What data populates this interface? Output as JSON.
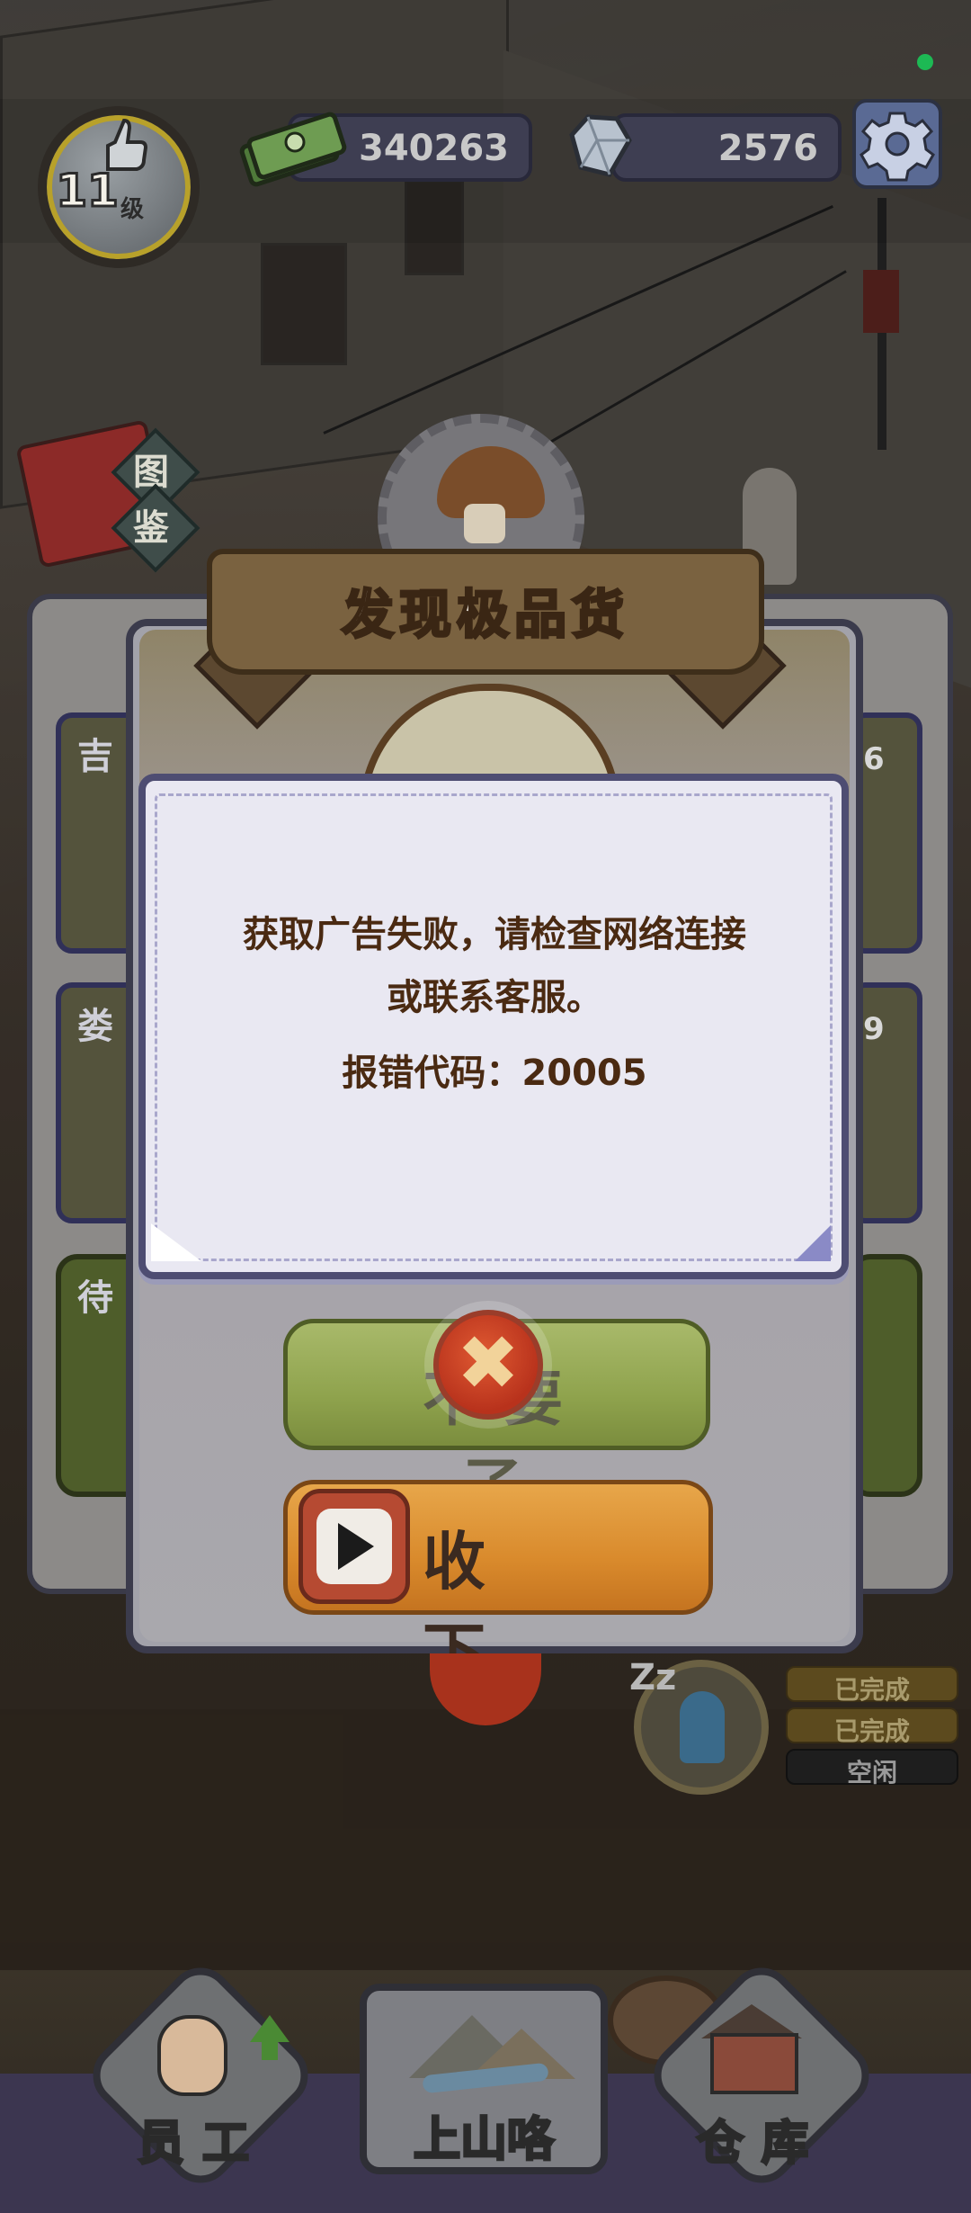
{
  "hud": {
    "level_number": "11",
    "level_unit": "级",
    "cash_amount": "340263",
    "gem_amount": "2576",
    "settings_icon": "gear-icon",
    "cash_icon": "cash-stack-icon",
    "gem_icon": "diamond-gem-icon"
  },
  "side": {
    "encyclopedia_chars": [
      "图",
      "鉴"
    ]
  },
  "background_cards": {
    "left_tags": [
      "吉",
      "娄",
      "待"
    ],
    "right_badges": [
      "6",
      "9"
    ]
  },
  "reward_panel": {
    "title": "发现极品货",
    "decline_button_label": "不要了",
    "accept_button_label": "收 下",
    "accept_icon": "play-icon",
    "decline_icon": "close-icon"
  },
  "error_dialog": {
    "message_line1": "获取广告失败，请检查网络连接",
    "message_line2": "或联系客服。",
    "code_label": "报错代码：20005"
  },
  "worker_status": {
    "chips": [
      "已完成",
      "已完成",
      "空闲"
    ],
    "sleep_text": "Zz"
  },
  "bottom_nav": {
    "items": [
      {
        "label": "员工",
        "icon": "staff-avatar-icon"
      },
      {
        "label": "上山咯",
        "icon": "mountain-icon"
      },
      {
        "label": "仓库",
        "icon": "warehouse-icon"
      }
    ]
  },
  "colors": {
    "dialog_text": "#4a2a12",
    "decline_button": "#8fa34d",
    "accept_button": "#d98a2c",
    "status_online": "#1db954"
  }
}
